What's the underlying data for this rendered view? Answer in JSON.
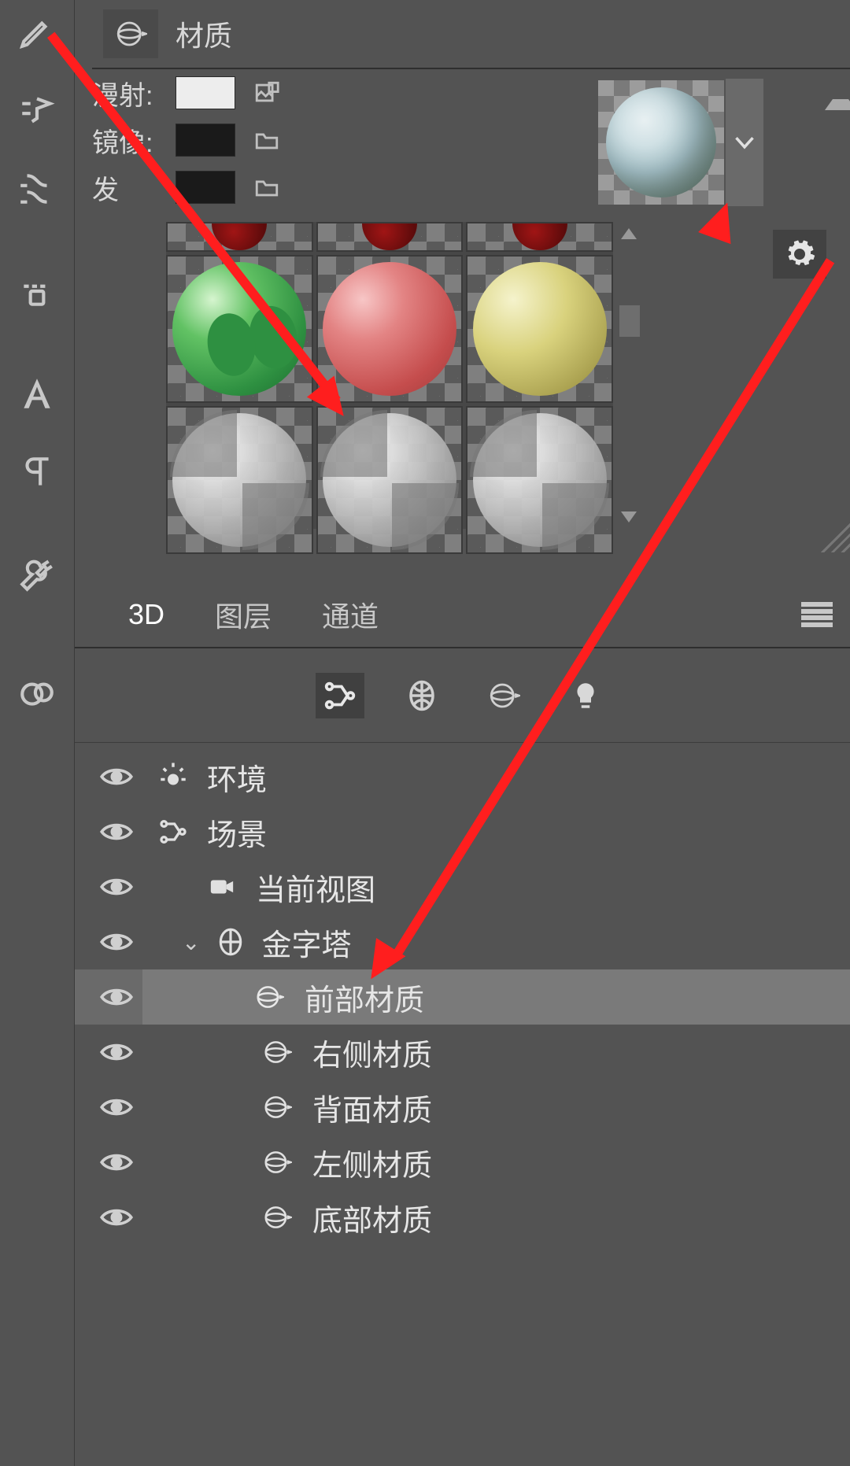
{
  "materials": {
    "title": "材质",
    "props": {
      "diffuse_label": "漫射:",
      "mirror_label": "镜像:",
      "glow_label_partial": "发"
    },
    "preview_dropdown_glyph": "v"
  },
  "filters": {
    "scene": "scene",
    "mesh": "mesh",
    "materials": "materials",
    "lights": "lights"
  },
  "panel3d": {
    "tabs": {
      "t3d": "3D",
      "layers": "图层",
      "channels": "通道"
    },
    "tree": {
      "env": "环境",
      "scene": "场景",
      "current_view": "当前视图",
      "pyramid": "金字塔",
      "front_mat": "前部材质",
      "right_mat": "右侧材质",
      "back_mat": "背面材质",
      "left_mat": "左侧材质",
      "bottom_mat": "底部材质"
    }
  }
}
